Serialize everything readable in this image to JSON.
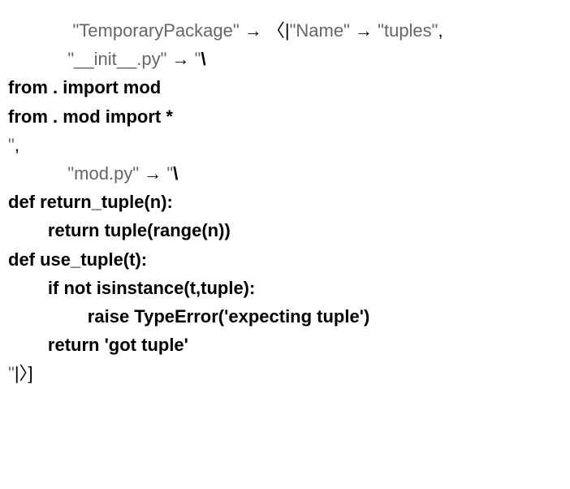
{
  "line1": {
    "label": "\"TemporaryPackage\"",
    "arrow": "→",
    "open": "〈|",
    "nameKey": "\"Name\"",
    "arrow2": "→",
    "nameVal": "\"tuples\"",
    "comma": ","
  },
  "line2": {
    "initKey": "\"__init__.py\"",
    "arrow": "→",
    "strStart": "\"\\"
  },
  "line3": "from . import mod",
  "line4": "from . mod import *",
  "line5": {
    "close": "\"",
    "comma": ","
  },
  "line6": {
    "modKey": "\"mod.py\"",
    "arrow": "→",
    "strStart": "\"\\"
  },
  "line7": "def return_tuple(n):",
  "line8": "        return tuple(range(n))",
  "line9": "def use_tuple(t):",
  "line10": "        if not isinstance(t,tuple):",
  "line11": "                raise TypeError('expecting tuple')",
  "line12": "        return 'got tuple'",
  "line13": {
    "close": "\"",
    "closeAssoc": "|〉]"
  }
}
